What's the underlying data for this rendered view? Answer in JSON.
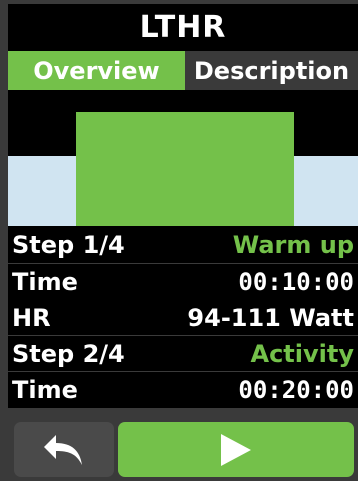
{
  "header": {
    "title": "LTHR"
  },
  "tabs": [
    {
      "label": "Overview",
      "active": true
    },
    {
      "label": "Description",
      "active": false
    }
  ],
  "steps": [
    {
      "step_label": "Step 1/4",
      "step_name": "Warm up",
      "time_label": "Time",
      "time_value": "00:10:00",
      "hr_label": "HR",
      "hr_value": "94-111 Watt"
    },
    {
      "step_label": "Step 2/4",
      "step_name": "Activity",
      "time_label": "Time",
      "time_value": "00:20:00"
    }
  ],
  "colors": {
    "accent": "#74c14a",
    "background": "#000000",
    "zone_band": "#d0e4f1",
    "frame": "#3a3a3a"
  },
  "footer": {
    "back_icon": "back-arrow-icon",
    "play_icon": "play-icon"
  }
}
